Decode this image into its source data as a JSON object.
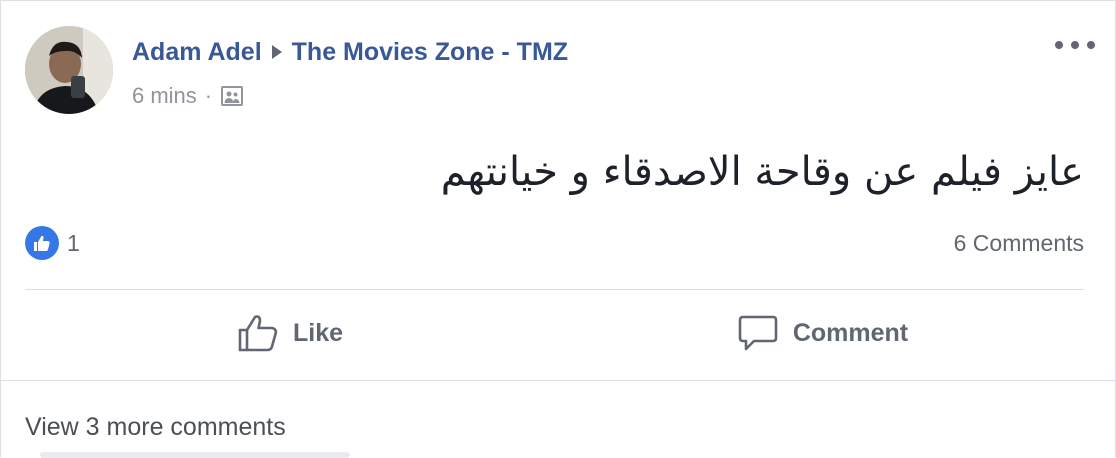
{
  "post": {
    "author": "Adam Adel",
    "group": "The Movies Zone - TMZ",
    "time": "6 mins",
    "meta_separator": "·",
    "text": "عايز فيلم عن وقاحة الاصدقاء و خيانتهم",
    "reactions": {
      "type": "like-icon",
      "count": "1"
    },
    "comments_count": "6 Comments"
  },
  "actions": {
    "like_label": "Like",
    "comment_label": "Comment"
  },
  "comments": {
    "view_more_label": "View 3 more comments"
  },
  "colors": {
    "link": "#385898",
    "secondary": "#606770",
    "like_blue": "#3578e5"
  }
}
